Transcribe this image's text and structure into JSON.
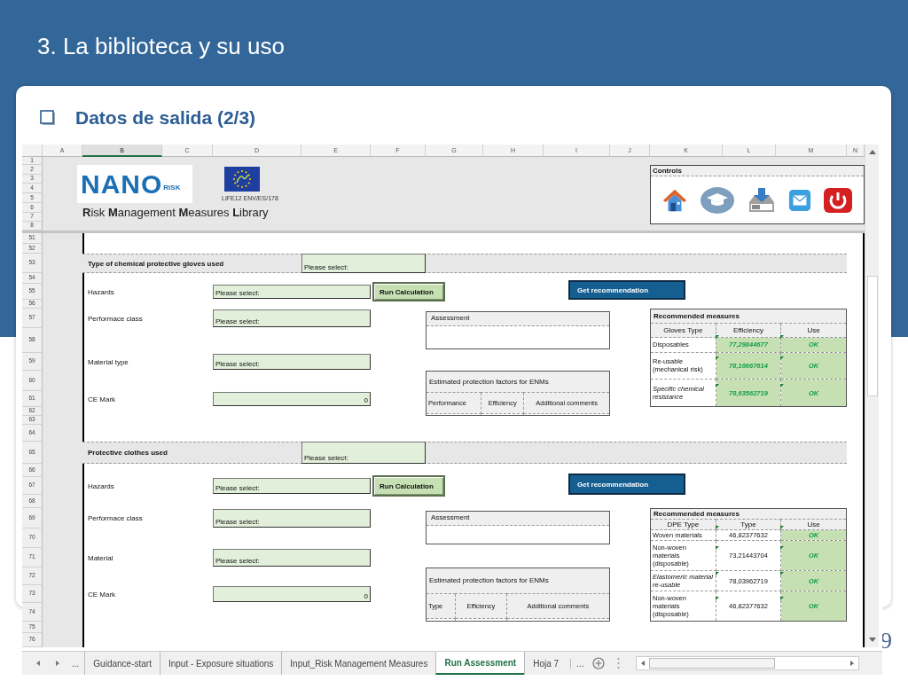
{
  "slide": {
    "title": "3. La biblioteca y su uso",
    "subtitle": "Datos de salida (2/3)",
    "page_number": "9"
  },
  "spreadsheet": {
    "columns": [
      {
        "label": "A",
        "selected": false
      },
      {
        "label": "B",
        "selected": true
      },
      {
        "label": "C",
        "selected": false
      },
      {
        "label": "D",
        "selected": false
      },
      {
        "label": "E",
        "selected": false
      },
      {
        "label": "F",
        "selected": false
      },
      {
        "label": "G",
        "selected": false
      },
      {
        "label": "H",
        "selected": false
      },
      {
        "label": "I",
        "selected": false
      },
      {
        "label": "J",
        "selected": false
      },
      {
        "label": "K",
        "selected": false
      },
      {
        "label": "L",
        "selected": false
      },
      {
        "label": "M",
        "selected": false
      },
      {
        "label": "N",
        "selected": false
      }
    ],
    "row_numbers": [
      "1",
      "2",
      "3",
      "4",
      "5",
      "6",
      "7",
      "8",
      "51",
      "52",
      "53",
      "54",
      "55",
      "56",
      "57",
      "58",
      "59",
      "60",
      "61",
      "62",
      "63",
      "64",
      "65",
      "66",
      "67",
      "68",
      "69",
      "70",
      "71",
      "72",
      "73",
      "74",
      "75",
      "76"
    ],
    "header": {
      "logo_text": "NANO",
      "logo_suffix": "RISK",
      "project_code": "LIFE12 ENV/ES/178",
      "title": "**R**isk **M**anagement **M**easures **L**ibrary"
    },
    "controls": {
      "title": "Controls"
    },
    "sections": [
      {
        "title": "Type of chemical protective gloves used",
        "selector": "Please select:",
        "fields": [
          {
            "label": "Hazards",
            "value": "Please select:",
            "kind": "select"
          },
          {
            "label": "Performace class",
            "value": "Please select:",
            "kind": "select"
          },
          {
            "label": "Material type",
            "value": "Please select:",
            "kind": "select"
          },
          {
            "label": "CE Mark",
            "value": "0",
            "kind": "number"
          }
        ],
        "run_button": "Run Calculation",
        "recommend_button": "Get recommendation",
        "assessment": {
          "title": "Assessment"
        },
        "protection": {
          "title": "Estimated protection factors for ENMs",
          "columns": [
            "Performance",
            "Efficiency",
            "Additional comments"
          ]
        },
        "recommended": {
          "title": "Recommended measures",
          "columns": [
            "Gloves Type",
            "Efficiency",
            "Use"
          ],
          "rows": [
            {
              "type": "Disposables",
              "italic": false,
              "value": "77,29844677",
              "value_highlighted": true,
              "use": "OK"
            },
            {
              "type": "Re-usable (mechanical risk)",
              "italic": false,
              "value": "78,16667614",
              "value_highlighted": true,
              "use": "OK"
            },
            {
              "type": "Specific chemical resistance",
              "italic": true,
              "value": "78,63562719",
              "value_highlighted": true,
              "use": "OK"
            }
          ]
        }
      },
      {
        "title": "Protective clothes used",
        "selector": "Please select:",
        "fields": [
          {
            "label": "Hazards",
            "value": "Please select:",
            "kind": "select"
          },
          {
            "label": "Performace class",
            "value": "Please select:",
            "kind": "select"
          },
          {
            "label": "Material",
            "value": "Please select:",
            "kind": "select"
          },
          {
            "label": "CE Mark",
            "value": "0",
            "kind": "number"
          }
        ],
        "run_button": "Run Calculation",
        "recommend_button": "Get recommendation",
        "assessment": {
          "title": "Assessment"
        },
        "protection": {
          "title": "Estimated protection factors for ENMs",
          "columns": [
            "Type",
            "Efficiency",
            "Additional comments"
          ]
        },
        "recommended": {
          "title": "Recommended measures",
          "columns": [
            "DPE Type",
            "Type",
            "Use"
          ],
          "rows": [
            {
              "type": "Woven materials",
              "italic": false,
              "value": "46,82377632",
              "value_highlighted": false,
              "use": "OK"
            },
            {
              "type": "Non-woven materials (disposable)",
              "italic": false,
              "value": "73,21443704",
              "value_highlighted": false,
              "use": "OK"
            },
            {
              "type": "Elastomeric material re-usable",
              "italic": true,
              "value": "78,03962719",
              "value_highlighted": false,
              "use": "OK"
            },
            {
              "type": "Non-woven materials (disposable)",
              "italic": false,
              "value": "46,82377632",
              "value_highlighted": false,
              "use": "OK"
            }
          ]
        }
      }
    ],
    "tab_overflow_left": "...",
    "sheet_tabs": [
      {
        "label": "Guidance-start",
        "selected": false
      },
      {
        "label": "Input - Exposure situations",
        "selected": false
      },
      {
        "label": "Input_Risk Management Measures",
        "selected": false
      },
      {
        "label": "Run Assessment",
        "selected": true
      },
      {
        "label": "Hoja 7",
        "selected": false
      }
    ],
    "tab_overflow_right": "..."
  }
}
